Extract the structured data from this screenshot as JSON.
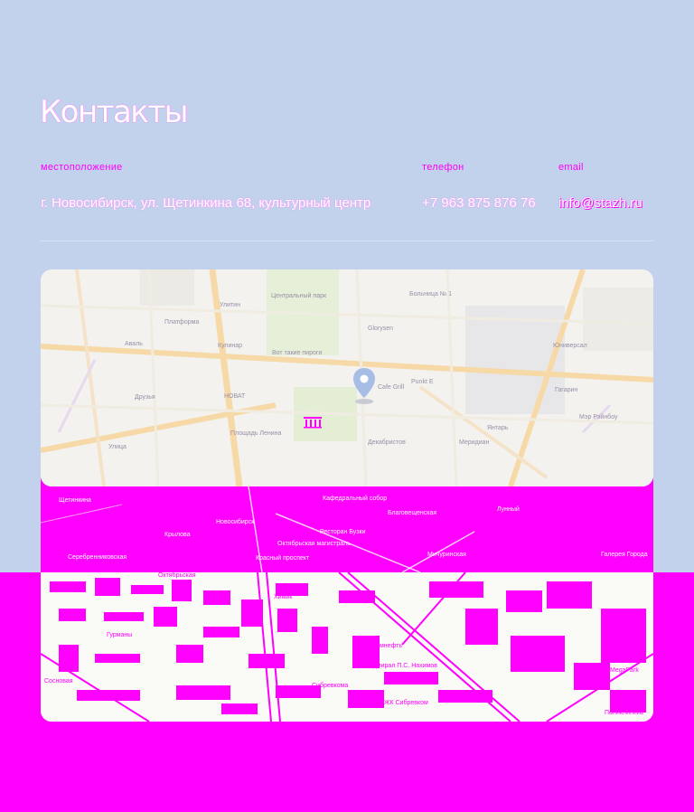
{
  "page": {
    "title": "Контакты"
  },
  "contacts": {
    "address": {
      "label": "местоположение",
      "value": "г. Новосибирск, ул. Щетинкина 68, культурный центр"
    },
    "phone": {
      "label": "телефон",
      "value": "+7 963 875 876 76"
    },
    "email": {
      "label": "email",
      "value": "info@stazh.ru"
    }
  },
  "map": {
    "icon": "map-pin-icon",
    "labels_top": [
      "Центральный парк",
      "Больница № 1",
      "Улитин",
      "Платформа",
      "Glorysen",
      "Кулинар",
      "Аваль",
      "Вот такие пироги",
      "Юниверсал",
      "Гагарин",
      "Друзья",
      "НОВАТ",
      "Cafe Grill",
      "Punkt E",
      "Мэр Рэйнбоу",
      "Площадь Ленина",
      "Улица",
      "Янтарь",
      "Меридиан",
      "Декабристов"
    ],
    "labels_bottom_band": [
      "Щетинкина",
      "Кафедральный собор",
      "Благовещенская",
      "Лунный",
      "Крылова",
      "Октябрьская магистраль",
      "Новосибирск",
      "Ресторан Бузки",
      "Красный проспект",
      "Серебренниковская",
      "Мичуринская",
      "Галерея Города"
    ],
    "labels_bottom": [
      "Октябрьская",
      "Химик",
      "Газпромнефть",
      "Адмирал П.С. Нахимов",
      "Гурманы",
      "Кранон",
      "ЖК Сибревком",
      "Лукойл",
      "Сибревкома",
      "MegaPark",
      "Поликлиника",
      "Сосновая"
    ]
  },
  "colors": {
    "background": "#c2d1ec",
    "accent": "#ff00ff",
    "text": "#ffffff"
  }
}
